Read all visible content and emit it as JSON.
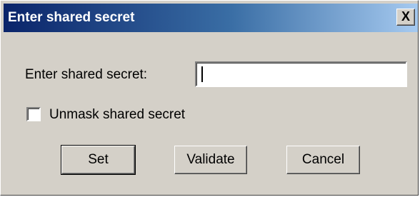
{
  "window": {
    "title": "Enter shared secret",
    "close_symbol": "X"
  },
  "form": {
    "secret_label": "Enter shared secret:",
    "secret_value": "",
    "unmask_label": "Unmask shared secret",
    "unmask_checked": false
  },
  "buttons": {
    "set": "Set",
    "validate": "Validate",
    "cancel": "Cancel"
  },
  "icons": {
    "close": "close-icon",
    "checkbox": "checkbox-unchecked"
  },
  "colors": {
    "title_gradient_start": "#0a246a",
    "title_gradient_end": "#a6caf0",
    "face": "#d4d0c8"
  }
}
